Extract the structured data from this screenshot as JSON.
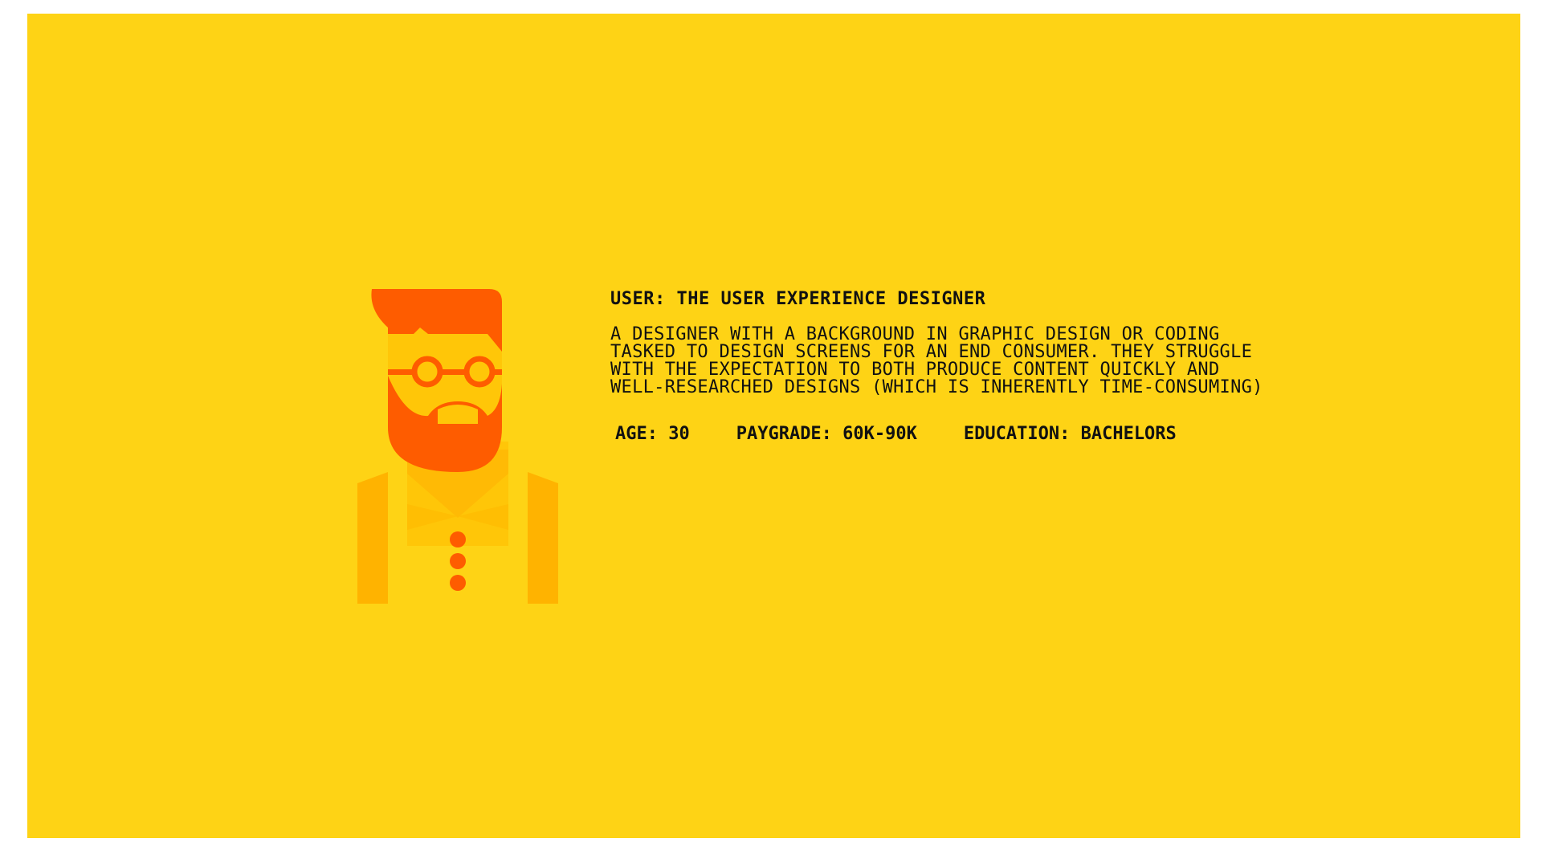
{
  "persona": {
    "title": "USER: THE USER EXPERIENCE DESIGNER",
    "description_lines": [
      "A DESIGNER WITH A BACKGROUND IN GRAPHIC DESIGN OR CODING",
      "TASKED TO DESIGN SCREENS FOR AN END CONSUMER. THEY STRUGGLE",
      "WITH THE EXPECTATION TO BOTH PRODUCE CONTENT QUICKLY AND",
      "WELL-RESEARCHED DESIGNS (WHICH IS INHERENTLY TIME-CONSUMING)"
    ],
    "stats": {
      "age": "AGE: 30",
      "paygrade": "PAYGRADE: 60K-90K",
      "education": "EDUCATION: BACHELORS"
    },
    "avatar_icon": "bearded-designer-avatar-icon"
  },
  "colors": {
    "background": "#fed315",
    "hair_beard": "#fe5c00",
    "vest": "#ffb300",
    "shirt": "#ffc608",
    "text": "#111111"
  }
}
